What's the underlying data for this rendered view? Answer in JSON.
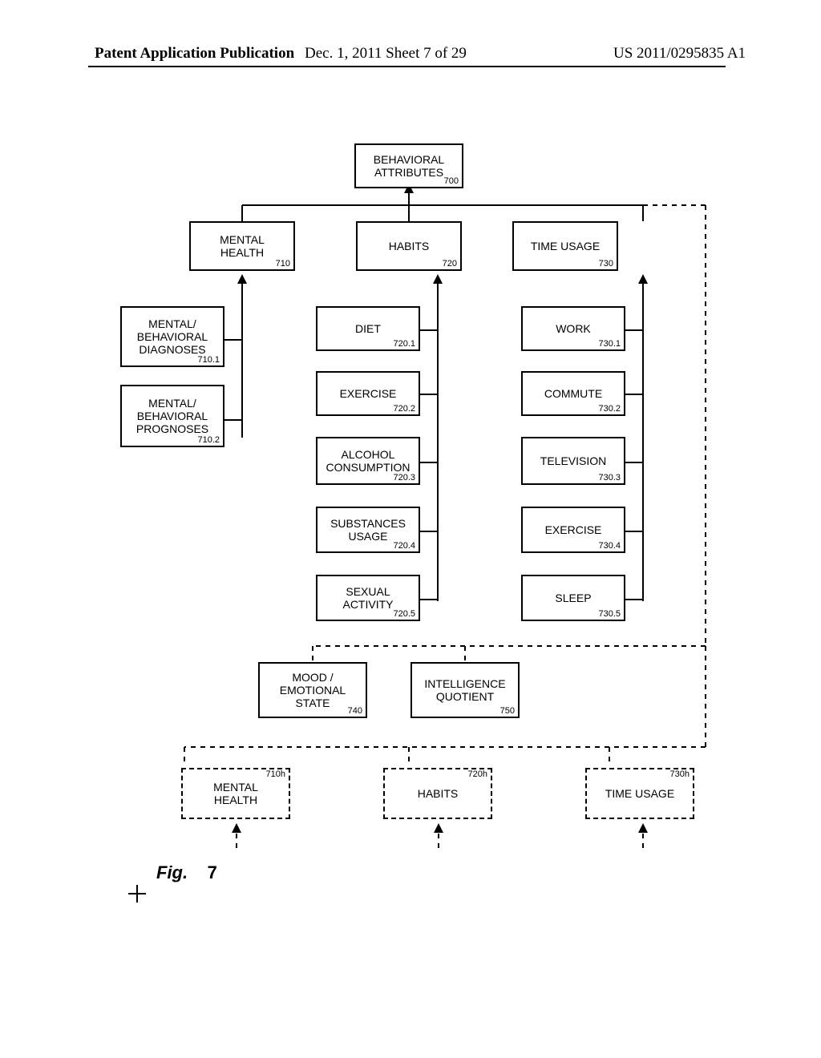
{
  "header": {
    "left": "Patent Application Publication",
    "middle": "Dec. 1, 2011   Sheet 7 of 29",
    "right": "US 2011/0295835 A1"
  },
  "fig": {
    "label": "Fig.",
    "num": "7"
  },
  "nodes": {
    "n700": {
      "label": "BEHAVIORAL\nATTRIBUTES",
      "ref": "700"
    },
    "n710": {
      "label": "MENTAL\nHEALTH",
      "ref": "710"
    },
    "n720": {
      "label": "HABITS",
      "ref": "720"
    },
    "n730": {
      "label": "TIME USAGE",
      "ref": "730"
    },
    "n710_1": {
      "label": "MENTAL/\nBEHAVIORAL\nDIAGNOSES",
      "ref": "710.1"
    },
    "n710_2": {
      "label": "MENTAL/\nBEHAVIORAL\nPROGNOSES",
      "ref": "710.2"
    },
    "n720_1": {
      "label": "DIET",
      "ref": "720.1"
    },
    "n720_2": {
      "label": "EXERCISE",
      "ref": "720.2"
    },
    "n720_3": {
      "label": "ALCOHOL\nCONSUMPTION",
      "ref": "720.3"
    },
    "n720_4": {
      "label": "SUBSTANCES\nUSAGE",
      "ref": "720.4"
    },
    "n720_5": {
      "label": "SEXUAL\nACTIVITY",
      "ref": "720.5"
    },
    "n730_1": {
      "label": "WORK",
      "ref": "730.1"
    },
    "n730_2": {
      "label": "COMMUTE",
      "ref": "730.2"
    },
    "n730_3": {
      "label": "TELEVISION",
      "ref": "730.3"
    },
    "n730_4": {
      "label": "EXERCISE",
      "ref": "730.4"
    },
    "n730_5": {
      "label": "SLEEP",
      "ref": "730.5"
    },
    "n740": {
      "label": "MOOD /\nEMOTIONAL\nSTATE",
      "ref": "740"
    },
    "n750": {
      "label": "INTELLIGENCE\nQUOTIENT",
      "ref": "750"
    },
    "n710h": {
      "label": "MENTAL\nHEALTH",
      "ref": "710h"
    },
    "n720h": {
      "label": "HABITS",
      "ref": "720h"
    },
    "n730h": {
      "label": "TIME USAGE",
      "ref": "730h"
    }
  },
  "chart_data": {
    "type": "table",
    "title": "Fig. 7 — Behavioral Attributes hierarchy",
    "tree": {
      "id": "700",
      "label": "BEHAVIORAL ATTRIBUTES",
      "children": [
        {
          "id": "710",
          "label": "MENTAL HEALTH",
          "children": [
            {
              "id": "710.1",
              "label": "MENTAL/BEHAVIORAL DIAGNOSES"
            },
            {
              "id": "710.2",
              "label": "MENTAL/BEHAVIORAL PROGNOSES"
            }
          ]
        },
        {
          "id": "720",
          "label": "HABITS",
          "children": [
            {
              "id": "720.1",
              "label": "DIET"
            },
            {
              "id": "720.2",
              "label": "EXERCISE"
            },
            {
              "id": "720.3",
              "label": "ALCOHOL CONSUMPTION"
            },
            {
              "id": "720.4",
              "label": "SUBSTANCES USAGE"
            },
            {
              "id": "720.5",
              "label": "SEXUAL ACTIVITY"
            }
          ]
        },
        {
          "id": "730",
          "label": "TIME USAGE",
          "children": [
            {
              "id": "730.1",
              "label": "WORK"
            },
            {
              "id": "730.2",
              "label": "COMMUTE"
            },
            {
              "id": "730.3",
              "label": "TELEVISION"
            },
            {
              "id": "730.4",
              "label": "EXERCISE"
            },
            {
              "id": "730.5",
              "label": "SLEEP"
            }
          ]
        },
        {
          "id": "740",
          "label": "MOOD / EMOTIONAL STATE"
        },
        {
          "id": "750",
          "label": "INTELLIGENCE QUOTIENT"
        },
        {
          "id": "710h",
          "label": "MENTAL HEALTH",
          "style": "dashed"
        },
        {
          "id": "720h",
          "label": "HABITS",
          "style": "dashed"
        },
        {
          "id": "730h",
          "label": "TIME USAGE",
          "style": "dashed"
        }
      ]
    }
  }
}
